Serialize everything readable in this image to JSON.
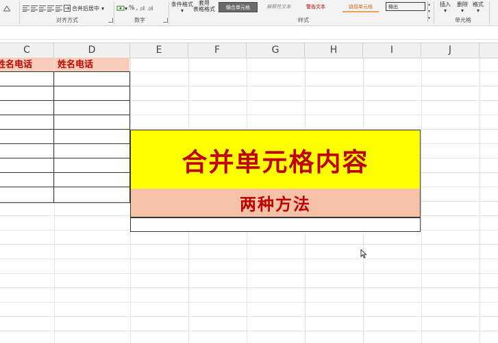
{
  "ribbon": {
    "merge_center_label": "合并后居中",
    "percent_label": "%",
    "conditional_format_label": "条件格式",
    "table_format_label_1": "套用",
    "table_format_label_2": "表格格式",
    "cell_styles": [
      "输合单元格",
      "解释性文本",
      "警告文本",
      "链接单元格",
      "输出"
    ],
    "insert_label": "插入",
    "delete_label": "删除",
    "format_label": "格式",
    "groups": {
      "alignment": "对齐方式",
      "number": "数字",
      "styles": "样式",
      "cells": "单元格"
    }
  },
  "columns": [
    "C",
    "D",
    "E",
    "F",
    "G",
    "H",
    "I",
    "J"
  ],
  "table": {
    "header_c": "姓名电话",
    "header_d": "姓名电话"
  },
  "merged": {
    "title": "合并单元格内容",
    "subtitle": "两种方法"
  },
  "colors": {
    "title_bg": "#ffff00",
    "subtitle_bg": "#f5c2a8",
    "header_bg": "#f8cdb9",
    "text_red": "#c00000"
  }
}
